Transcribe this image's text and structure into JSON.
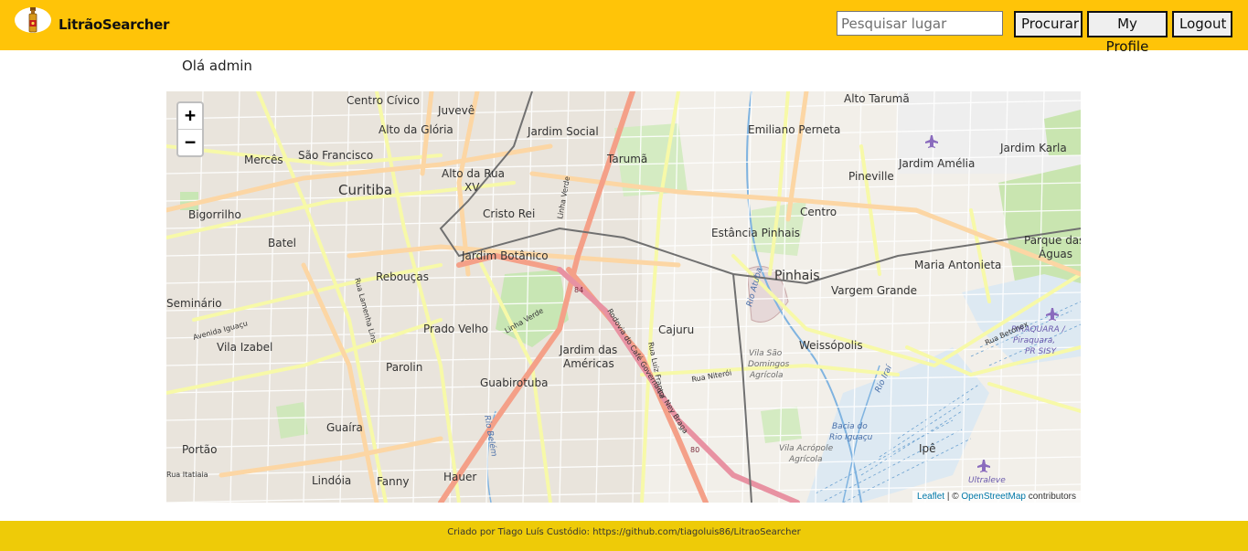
{
  "navbar": {
    "brand": "LitrãoSearcher",
    "search_placeholder": "Pesquisar lugar",
    "search_value": "",
    "search_button": "Procurar",
    "profile_button": "My Profile",
    "logout_button": "Logout",
    "color": "#ffc408"
  },
  "greeting": "Olá admin",
  "map": {
    "zoom_in": "+",
    "zoom_out": "−",
    "attribution": {
      "leaflet": "Leaflet",
      "separator": " | © ",
      "osm": "OpenStreetMap",
      "suffix": " contributors"
    },
    "labels": {
      "centro_civico": "Centro Cívico",
      "juveve": "Juvevê",
      "alto_taruma": "Alto Tarumã",
      "alto_gloria": "Alto da Glória",
      "jardim_social": "Jardim Social",
      "emiliano_perneta": "Emiliano Perneta",
      "merces": "Mercês",
      "sao_francisco": "São Francisco",
      "taruma": "Tarumã",
      "jardim_amelia": "Jardim Amélia",
      "jardim_karla": "Jardim Karla",
      "alto_rua_xv_1": "Alto da Rua",
      "alto_rua_xv_2": "XV",
      "pineville": "Pineville",
      "curitiba": "Curitiba",
      "bigorrilho": "Bigorrilho",
      "cristo_rei": "Cristo Rei",
      "centro": "Centro",
      "batel": "Batel",
      "estancia_pinhais": "Estância Pinhais",
      "parque_aguas_1": "Parque das",
      "parque_aguas_2": "Águas",
      "jardim_botanico": "Jardim Botânico",
      "maria_antonieta": "Maria Antonieta",
      "pinhais": "Pinhais",
      "reboucas": "Rebouças",
      "vargem_grande": "Vargem Grande",
      "seminario": "Seminário",
      "cajuru": "Cajuru",
      "prado_velho": "Prado Velho",
      "vila_izabel": "Vila Izabel",
      "jardim_americas_1": "Jardim das",
      "jardim_americas_2": "Américas",
      "weissopolis": "Weissópolis",
      "piraquara_1": "PIRAQUARA /",
      "piraquara_2": "Piraquara,",
      "piraquara_3": "PR SISY",
      "parolin": "Parolin",
      "guabirotuba": "Guabirotuba",
      "vila_sao_domingos_1": "Vila São",
      "vila_sao_domingos_2": "Domingos",
      "vila_sao_domingos_3": "Agrícola",
      "guaira": "Guaíra",
      "bacia_1": "Bacia do",
      "bacia_2": "Rio Iguaçu",
      "portao": "Portão",
      "vila_acropole_1": "Vila Acrópole",
      "vila_acropole_2": "Agrícola",
      "ipe": "Ipê",
      "lindoia": "Lindóia",
      "fanny": "Fanny",
      "hauer": "Hauer",
      "ultraleve": "Ultraleve",
      "linha_verde": "Linha Verde",
      "rodovia": "Rodovia do Café Governador Ney Braga",
      "rua_luiz_franca": "Rua Luiz França",
      "rua_niteroi": "Rua Niterói",
      "rua_betonex": "Rua Betonex",
      "avenida_iguacu": "Avenida Iguaçu",
      "rua_lamenha_lins": "Rua Lamenha Lins",
      "rua_itatiaia": "Rua Itatiaia",
      "rio_belem": "Rio Belém",
      "rio_atuba": "Rio Atuba",
      "rio_iraí": "Rio Iraí",
      "br_84": "84",
      "br_80": "80"
    }
  },
  "footer": {
    "text": "Criado por Tiago Luís Custódio: https://github.com/tiagoluis86/LitraoSearcher"
  }
}
